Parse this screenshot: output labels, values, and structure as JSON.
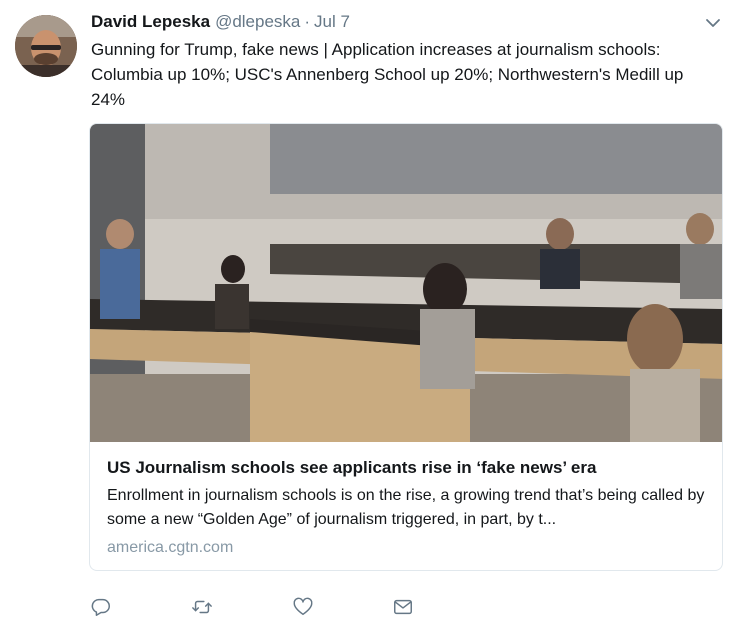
{
  "tweet": {
    "author_name": "David Lepeska",
    "author_handle": "@dlepeska",
    "separator": "·",
    "timestamp": "Jul 7",
    "text": "Gunning for Trump, fake news | Application increases at journalism schools: Columbia up 10%; USC's Annenberg School up 20%; Northwestern's Medill up 24%"
  },
  "card": {
    "image_icon": "classroom-photo",
    "title": "US Journalism schools see applicants rise in ‘fake news’ era",
    "description": "Enrollment in journalism schools is on the rise, a growing trend that’s being called by some a new “Golden Age” of journalism triggered, in part, by t...",
    "domain": "america.cgtn.com"
  },
  "actions": {
    "reply_icon": "reply-icon",
    "retweet_icon": "retweet-icon",
    "like_icon": "heart-icon",
    "message_icon": "envelope-icon"
  },
  "colors": {
    "text_primary": "#14171a",
    "text_secondary": "#657786",
    "icon_gray": "#657786",
    "border": "#e1e8ed"
  }
}
